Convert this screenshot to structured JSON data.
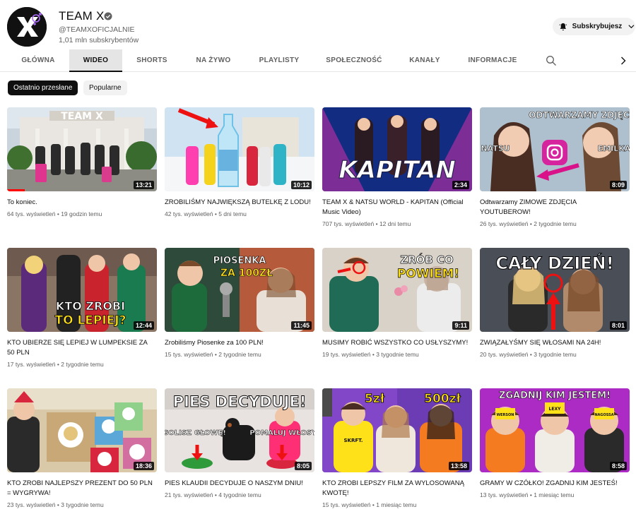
{
  "channel": {
    "name": "TEAM X",
    "handle": "@TEAMXOFICJALNIE",
    "subscribers": "1,01 mln subskrybentów",
    "subscribe_label": "Subskrybujesz"
  },
  "tabs": [
    {
      "label": "GŁÓWNA",
      "active": false
    },
    {
      "label": "WIDEO",
      "active": true
    },
    {
      "label": "SHORTS",
      "active": false
    },
    {
      "label": "NA ŻYWO",
      "active": false
    },
    {
      "label": "PLAYLISTY",
      "active": false
    },
    {
      "label": "SPOŁECZNOŚĆ",
      "active": false
    },
    {
      "label": "KANAŁY",
      "active": false
    },
    {
      "label": "INFORMACJE",
      "active": false
    }
  ],
  "filters": [
    {
      "label": "Ostatnio przesłane",
      "active": true
    },
    {
      "label": "Popularne",
      "active": false
    }
  ],
  "videos": [
    {
      "title": "To koniec.",
      "views": "64 tys. wyświetleń",
      "age": "19 godzin temu",
      "duration": "13:21",
      "thumb_text": "TEAM X",
      "watched": 1
    },
    {
      "title": "ZROBILIŚMY NAJWIĘKSZĄ BUTELKĘ Z LODU!",
      "views": "42 tys. wyświetleń",
      "age": "5 dni temu",
      "duration": "10:12",
      "thumb_text": "",
      "watched": 0
    },
    {
      "title": "TEAM X & NATSU WORLD - KAPITAN (Official Music Video)",
      "views": "707 tys. wyświetleń",
      "age": "12 dni temu",
      "duration": "2:34",
      "thumb_text": "KAPITAN",
      "watched": 0
    },
    {
      "title": "Odtwarzamy ZIMOWE ZDJĘCIA YOUTUBEROW!",
      "views": "26 tys. wyświetleń",
      "age": "2 tygodnie temu",
      "duration": "8:09",
      "thumb_text": "ODTWARZAMY ZDJĘCIA!",
      "thumb_text_2": "NATSU",
      "thumb_text_3": "EMILKA",
      "watched": 0
    },
    {
      "title": "KTO UBIERZE SIĘ LEPIEJ W LUMPEKSIE ZA 50 PLN",
      "views": "17 tys. wyświetleń",
      "age": "2 tygodnie temu",
      "duration": "12:44",
      "thumb_text": "KTO ZROBI",
      "thumb_text_2": "TO LEPIEJ?",
      "watched": 0
    },
    {
      "title": "Zrobiliśmy Piosenke za 100 PLN!",
      "views": "15 tys. wyświetleń",
      "age": "2 tygodnie temu",
      "duration": "11:45",
      "thumb_text": "PIOSENKA",
      "thumb_text_2": "ZA 100ZŁ",
      "watched": 0
    },
    {
      "title": "MUSIMY ROBIĆ WSZYSTKO CO USŁYSZYMY!",
      "views": "19 tys. wyświetleń",
      "age": "3 tygodnie temu",
      "duration": "9:11",
      "thumb_text": "ZRÓB CO",
      "thumb_text_2": "POWIEM!",
      "watched": 0
    },
    {
      "title": "ZWIĄZAŁYŚMY SIĘ WŁOSAMI NA 24H!",
      "views": "20 tys. wyświetleń",
      "age": "3 tygodnie temu",
      "duration": "8:01",
      "thumb_text": "CAŁY DZIEŃ!",
      "watched": 0
    },
    {
      "title": "KTO ZROBI NAJLEPSZY PREZENT DO 50 PLN = WYGRYWA!",
      "views": "23 tys. wyświetleń",
      "age": "3 tygodnie temu",
      "duration": "18:36",
      "thumb_text": "",
      "watched": 0
    },
    {
      "title": "PIES KLAUDII DECYDUJE O NASZYM DNIU!",
      "views": "21 tys. wyświetleń",
      "age": "4 tygodnie temu",
      "duration": "8:05",
      "thumb_text": "PIES DECYDUJE!",
      "thumb_text_2": "GOLISZ GŁOWĘ!",
      "thumb_text_3": "POMALUJ WŁOSY!",
      "watched": 0
    },
    {
      "title": "KTO ZROBI LEPSZY FILM ZA WYLOSOWANĄ KWOTĘ!",
      "views": "15 tys. wyświetleń",
      "age": "1 miesiąc temu",
      "duration": "13:58",
      "thumb_text": "5zł",
      "thumb_text_2": "500zł",
      "thumb_text_3": "SKRFT.",
      "watched": 0
    },
    {
      "title": "GRAMY W CZÓŁKO! ZGADNIJ KIM JESTEŚ!",
      "views": "13 tys. wyświetleń",
      "age": "1 miesiąc temu",
      "duration": "8:58",
      "thumb_text": "ZGADNIJ KIM JESTEM!",
      "thumb_text_2": "WERSON",
      "thumb_text_3": "LEXY",
      "thumb_text_4": "NAGOSSA",
      "watched": 0
    }
  ],
  "icons": {
    "verified": "verified-check-icon",
    "bell": "bell-icon",
    "chevron": "chevron-down-icon",
    "search": "search-icon",
    "next": "chevron-right-icon"
  },
  "colors": {
    "accent_red": "#ff0000",
    "text_primary": "#0f0f0f",
    "text_secondary": "#606060",
    "chip_bg": "#f2f2f2"
  }
}
